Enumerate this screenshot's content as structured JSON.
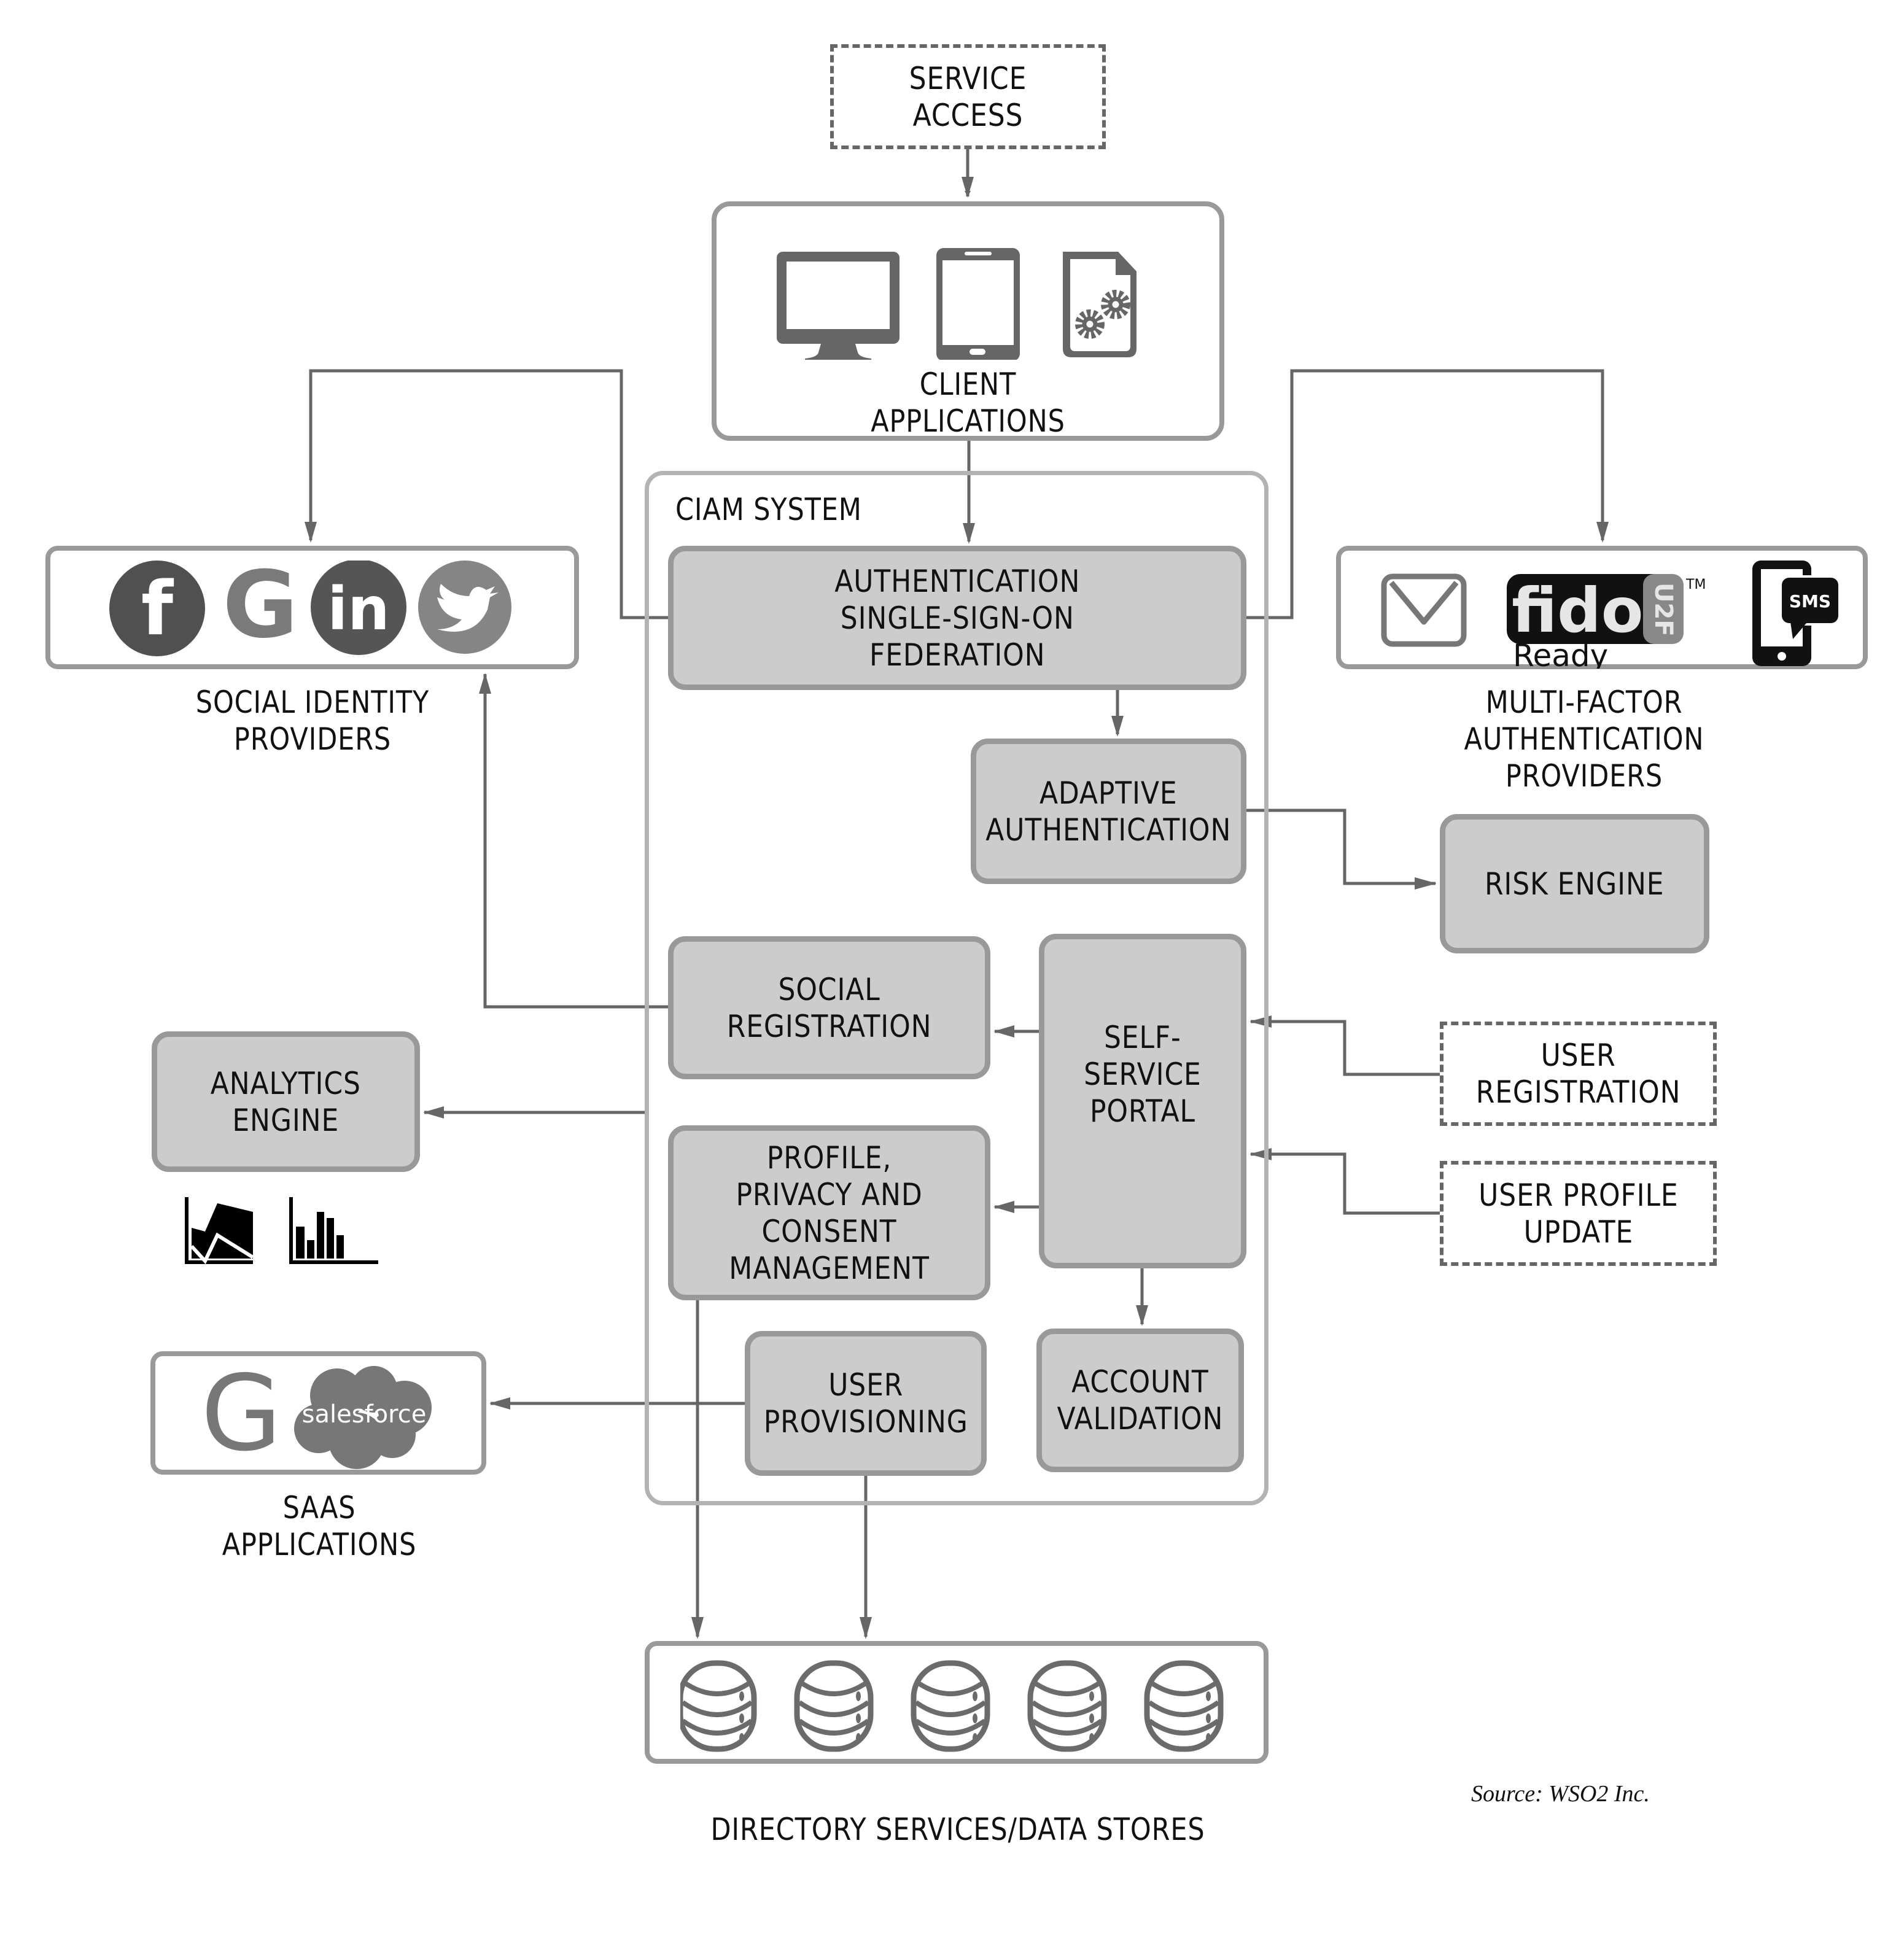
{
  "diagram": {
    "service_access": "SERVICE ACCESS",
    "client_applications": {
      "label": "CLIENT\nAPPLICATIONS",
      "icons": [
        "desktop-monitor-icon",
        "smartphone-icon",
        "app-settings-gears-icon"
      ]
    },
    "ciam_system": {
      "title": "CIAM SYSTEM",
      "modules": {
        "authentication": "AUTHENTICATION\nSINGLE-SIGN-ON\nFEDERATION",
        "adaptive": "ADAPTIVE\nAUTHENTICATION",
        "social_registration": "SOCIAL\nREGISTRATION",
        "self_service": "SELF-\nSERVICE\nPORTAL",
        "profile_privacy": "PROFILE,\nPRIVACY AND\nCONSENT\nMANAGEMENT",
        "user_provisioning": "USER\nPROVISIONING",
        "account_validation": "ACCOUNT\nVALIDATION"
      }
    },
    "social_identity_providers": {
      "label": "SOCIAL IDENTITY\nPROVIDERS",
      "icons": [
        {
          "name": "facebook-icon",
          "glyph": "f"
        },
        {
          "name": "google-icon",
          "glyph": "G"
        },
        {
          "name": "linkedin-icon",
          "glyph": "in"
        },
        {
          "name": "twitter-icon",
          "glyph": ""
        }
      ]
    },
    "mfa_providers": {
      "label": "MULTI-FACTOR\nAUTHENTICATION\nPROVIDERS",
      "email_icon": "email-envelope-icon",
      "fido": {
        "word": "fido",
        "badge": "U2F",
        "tm": "TM",
        "ready": "Ready"
      },
      "sms": "SMS"
    },
    "risk_engine": "RISK ENGINE",
    "analytics_engine": {
      "label": "ANALYTICS\nENGINE",
      "icons": [
        "area-chart-icon",
        "bar-chart-icon"
      ]
    },
    "saas_applications": {
      "label": "SAAS\nAPPLICATIONS",
      "google_glyph": "G",
      "salesforce": "salesforce"
    },
    "user_registration": "USER\nREGISTRATION",
    "user_profile_update": "USER PROFILE\nUPDATE",
    "directory_services": {
      "label": "DIRECTORY SERVICES/DATA STORES",
      "database_count": 5
    },
    "source": "Source: WSO2 Inc."
  },
  "colors": {
    "box_fill": "#cccccc",
    "box_border": "#999999",
    "connector": "#666666",
    "icon_dark": "#555555",
    "icon_mid": "#777777"
  }
}
